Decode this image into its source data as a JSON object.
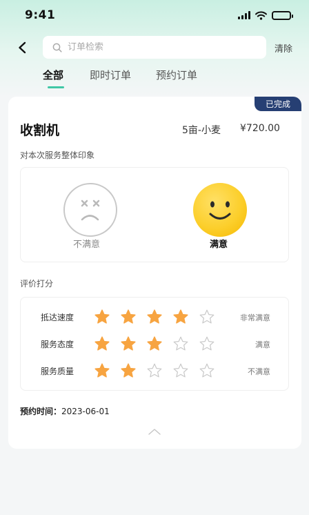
{
  "status_bar": {
    "time": "9:41"
  },
  "search": {
    "placeholder": "订单检索",
    "value": "",
    "clear_label": "清除"
  },
  "tabs": [
    {
      "label": "全部",
      "active": true
    },
    {
      "label": "即时订单",
      "active": false
    },
    {
      "label": "预约订单",
      "active": false
    }
  ],
  "order": {
    "status_badge": "已完成",
    "machine_name": "收割机",
    "spec": "5亩-小麦",
    "price": "¥720.00",
    "impression": {
      "section_label": "对本次服务整体印象",
      "options": [
        {
          "label": "不满意",
          "icon": "sad-face-icon",
          "selected": false
        },
        {
          "label": "满意",
          "icon": "happy-face-icon",
          "selected": true
        }
      ]
    },
    "rating": {
      "section_label": "评价打分",
      "max_stars": 5,
      "items": [
        {
          "label": "抵达速度",
          "stars": 4,
          "text": "非常满意"
        },
        {
          "label": "服务态度",
          "stars": 3,
          "text": "满意"
        },
        {
          "label": "服务质量",
          "stars": 2,
          "text": "不满意"
        }
      ]
    },
    "appointment": {
      "label": "预约时间：",
      "value": "2023-06-01"
    }
  },
  "colors": {
    "accent": "#3fc7a5",
    "star_filled": "#f7a441",
    "star_empty": "#c8c8c8",
    "badge_bg": "#263f73",
    "happy_face": "#fccf2c"
  }
}
